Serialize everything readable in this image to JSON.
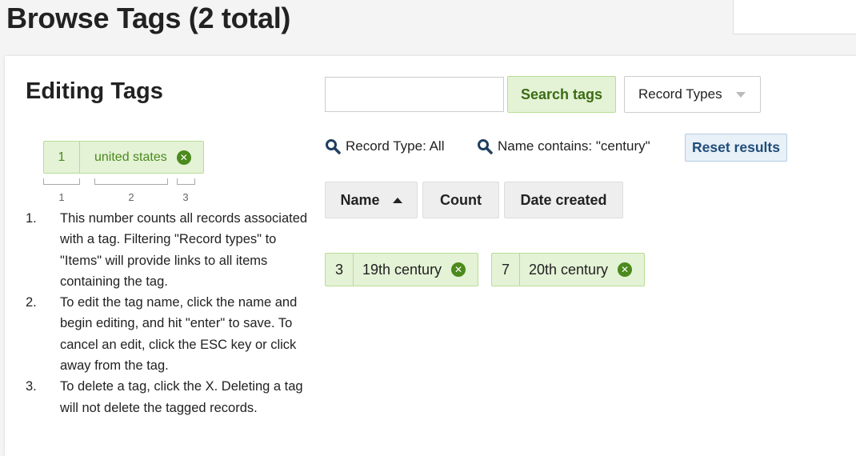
{
  "page": {
    "title": "Browse Tags (2 total)"
  },
  "editing": {
    "title": "Editing Tags",
    "example_tag": {
      "count": "1",
      "name": "united states"
    },
    "bracket_labels": [
      "1",
      "2",
      "3"
    ],
    "help": [
      {
        "num": "1.",
        "text": "This number counts all records associated with a tag. Filtering \"Record types\" to \"Items\" will provide links to all items containing the tag."
      },
      {
        "num": "2.",
        "text": "To edit the tag name, click the name and begin editing, and hit \"enter\" to save. To cancel an edit, click the ESC key or click away from the tag."
      },
      {
        "num": "3.",
        "text": "To delete a tag, click the X. Deleting a tag will not delete the tagged records."
      }
    ]
  },
  "search": {
    "value": "",
    "button_label": "Search tags",
    "record_types_selected": "Record Types"
  },
  "filters": {
    "record_type": "Record Type: All",
    "name_contains": "Name contains: \"century\"",
    "reset_label": "Reset results"
  },
  "sort": {
    "name_label": "Name",
    "count_label": "Count",
    "date_label": "Date created"
  },
  "tags": [
    {
      "count": "3",
      "name": "19th century"
    },
    {
      "count": "7",
      "name": "20th century"
    }
  ],
  "colors": {
    "tag_bg": "#e4f2d6",
    "tag_border": "#b8dd95",
    "tag_accent": "#4b8a1c",
    "reset_text": "#1f4d7a"
  }
}
